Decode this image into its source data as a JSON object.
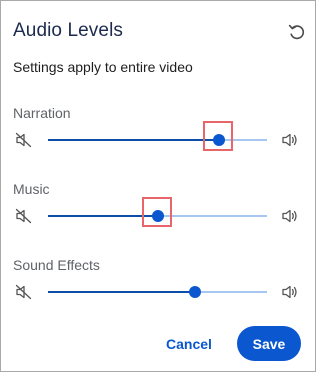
{
  "dialog": {
    "title": "Audio Levels",
    "subtitle": "Settings apply to entire video",
    "reset_icon": "reset-undo-icon"
  },
  "sliders": [
    {
      "label": "Narration",
      "value": 0.78,
      "highlighted": true
    },
    {
      "label": "Music",
      "value": 0.5,
      "highlighted": true
    },
    {
      "label": "Sound Effects",
      "value": 0.67,
      "highlighted": false
    }
  ],
  "icons": {
    "mute": "volume-mute-icon",
    "volume": "volume-up-icon"
  },
  "footer": {
    "cancel_label": "Cancel",
    "save_label": "Save"
  },
  "colors": {
    "accent": "#0b57d0",
    "fill": "#0a4ea8",
    "track": "#a6c8f0",
    "highlight": "#e8656a",
    "title": "#1b2a4e"
  }
}
